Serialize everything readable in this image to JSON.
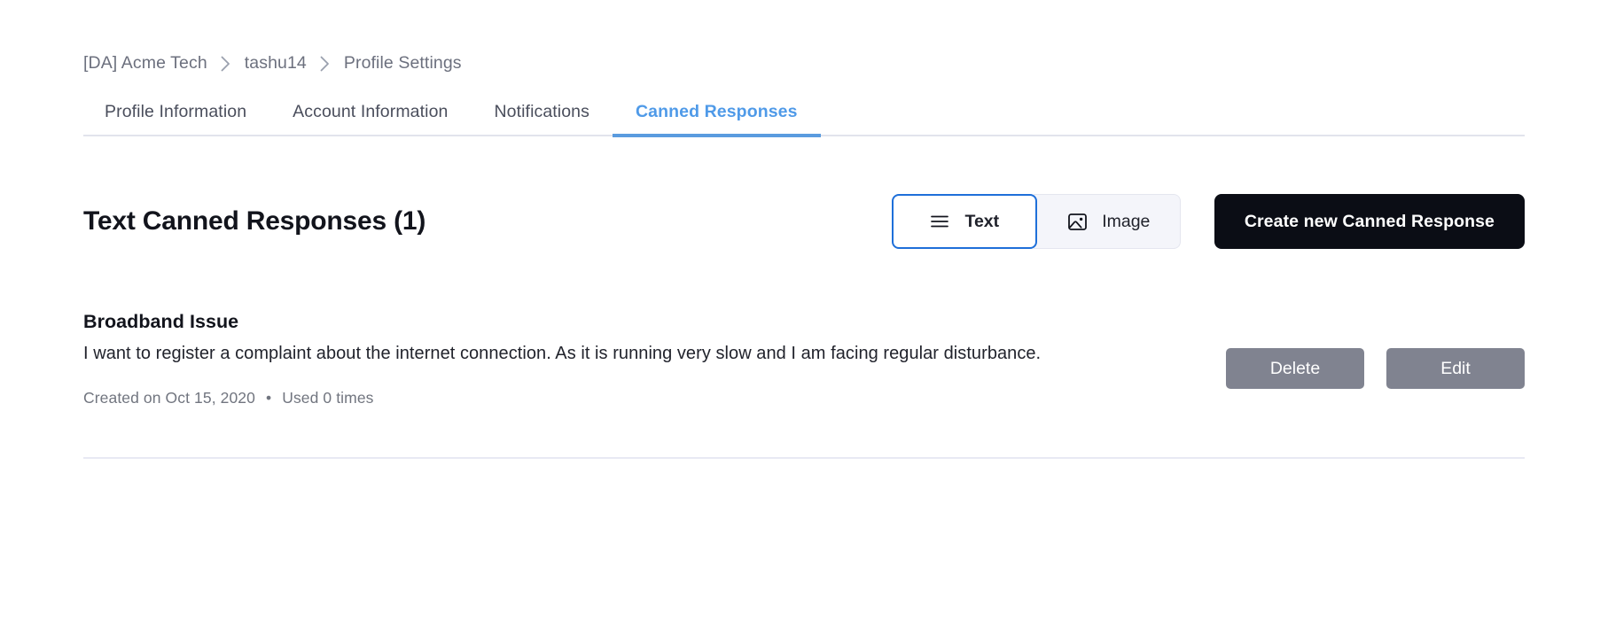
{
  "breadcrumb": {
    "items": [
      {
        "label": "[DA] Acme Tech"
      },
      {
        "label": "tashu14"
      },
      {
        "label": "Profile Settings"
      }
    ],
    "separator_icon": "chevron-right-icon"
  },
  "tabs": [
    {
      "label": "Profile Information",
      "active": false
    },
    {
      "label": "Account Information",
      "active": false
    },
    {
      "label": "Notifications",
      "active": false
    },
    {
      "label": "Canned Responses",
      "active": true
    }
  ],
  "section": {
    "title": "Text Canned Responses (1)",
    "count": 1
  },
  "segmented_control": {
    "selected": "Text",
    "options": [
      {
        "label": "Text",
        "icon": "list-lines-icon",
        "selected": true
      },
      {
        "label": "Image",
        "icon": "image-picture-icon",
        "selected": false
      }
    ]
  },
  "actions": {
    "create_label": "Create new Canned Response"
  },
  "responses": [
    {
      "title": "Broadband Issue",
      "body": "I want to register a complaint about the internet connection. As it is running very slow and I am facing regular disturbance.",
      "created_text": "Created on Oct 15, 2020",
      "separator": "•",
      "used_text": "Used 0 times",
      "delete_label": "Delete",
      "edit_label": "Edit"
    }
  ],
  "colors": {
    "accent_blue": "#5a9bdf",
    "active_tab_text": "#4f9ae8",
    "segment_border_blue": "#1e6fd9",
    "primary_button_bg": "#0b0d15",
    "gray_button_bg": "#808390",
    "divider": "#e8e9f3",
    "muted_text": "#71757f",
    "breadcrumb_text": "#6c707e"
  }
}
